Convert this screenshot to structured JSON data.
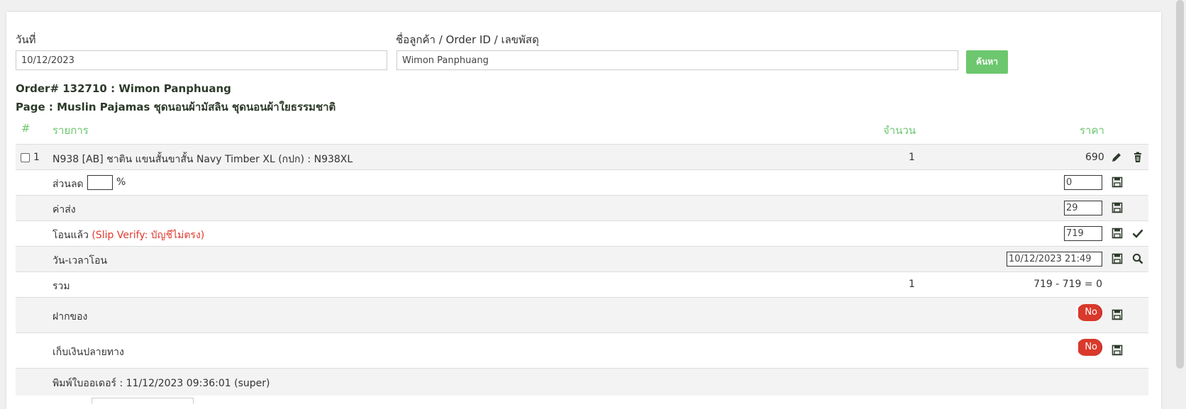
{
  "search": {
    "date_label": "วันที่",
    "date_value": "10/12/2023",
    "customer_label": "ชื่อลูกค้า / Order ID / เลขพัสดุ",
    "customer_value": "Wimon Panphuang",
    "search_button": "ค้นหา"
  },
  "order": {
    "title": "Order# 132710 : Wimon Panphuang",
    "page": "Page : Muslin Pajamas ชุดนอนผ้ามัสลิน ชุดนอนผ้าใยธรรมชาติ"
  },
  "table": {
    "headers": {
      "num": "#",
      "item": "รายการ",
      "qty": "จำนวน",
      "price": "ราคา"
    },
    "item_row": {
      "index": "1",
      "name": "N938 [AB] ชาติน แขนสั้นขาสั้น Navy Timber XL (กปก) : N938XL",
      "qty": "1",
      "price": "690"
    },
    "discount": {
      "label": "ส่วนลด",
      "percent_sign": "%",
      "percent_value": "",
      "value": "0"
    },
    "shipping": {
      "label": "ค่าส่ง",
      "value": "29"
    },
    "transferred": {
      "label": "โอนแล้ว",
      "slip_note": "(Slip Verify: บัญชีไม่ตรง)",
      "value": "719"
    },
    "transfer_datetime": {
      "label": "วัน-เวลาโอน",
      "value": "10/12/2023 21:49"
    },
    "total": {
      "label": "รวม",
      "qty": "1",
      "summary": "719 - 719 = 0"
    },
    "deposit": {
      "label": "ฝากของ",
      "toggle": "No"
    },
    "cod": {
      "label": "เก็บเงินปลายทาง",
      "toggle": "No"
    },
    "print": {
      "text": "พิมพ์ใบออเดอร์ : 11/12/2023 09:36:01 (super)"
    }
  },
  "colors": {
    "accent_green": "#6cc76e",
    "toggle_red": "#d9392b",
    "slip_red": "#e03a2e"
  }
}
